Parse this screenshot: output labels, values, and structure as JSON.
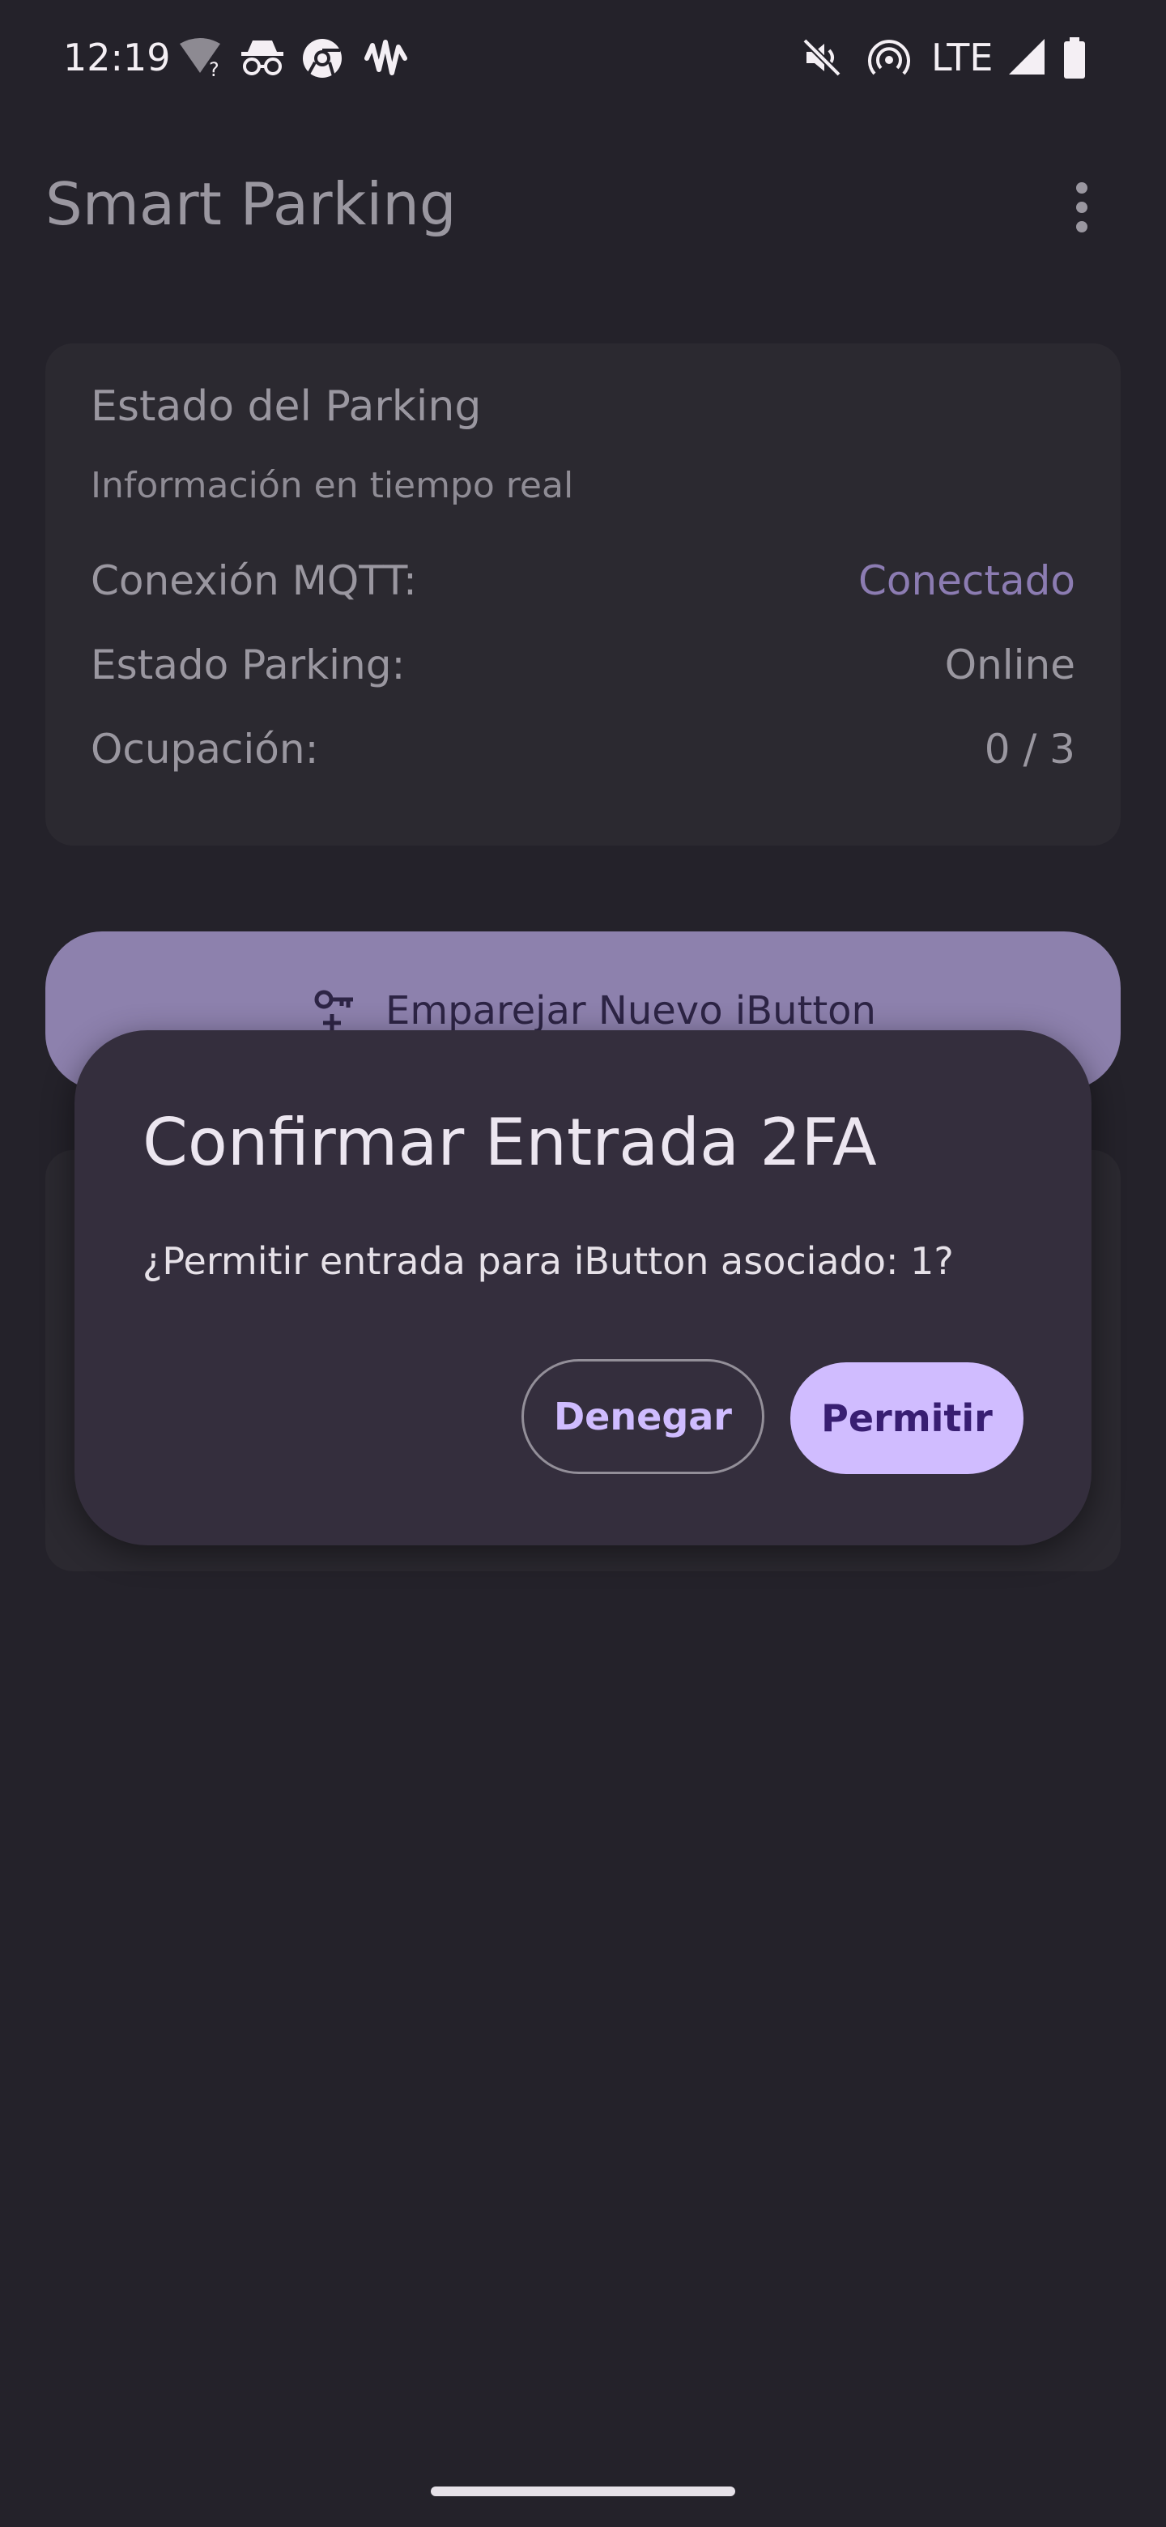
{
  "status_bar": {
    "time": "12:19",
    "network": "LTE",
    "icons": [
      "wifi-unknown-icon",
      "incognito-icon",
      "chrome-icon",
      "waveform-icon",
      "mute-icon",
      "hotspot-icon",
      "signal-icon",
      "battery-icon"
    ]
  },
  "app_bar": {
    "title": "Smart Parking",
    "overflow_icon": "more-vert-icon"
  },
  "status_card": {
    "title": "Estado del Parking",
    "subtitle": "Información en tiempo real",
    "rows": [
      {
        "label": "Conexión MQTT:",
        "value": "Conectado"
      },
      {
        "label": "Estado Parking:",
        "value": "Online"
      },
      {
        "label": "Ocupación:",
        "value": "0 / 3"
      }
    ]
  },
  "pair_button": {
    "label": "Emparejar Nuevo iButton",
    "icon": "key-plus-icon"
  },
  "dialog": {
    "title": "Confirmar Entrada 2FA",
    "message": "¿Permitir entrada para iButton asociado: 1?",
    "deny_label": "Denegar",
    "allow_label": "Permitir"
  },
  "colors": {
    "background": "#24222a",
    "accent": "#d0bcff",
    "dialog": "#342e3d"
  }
}
